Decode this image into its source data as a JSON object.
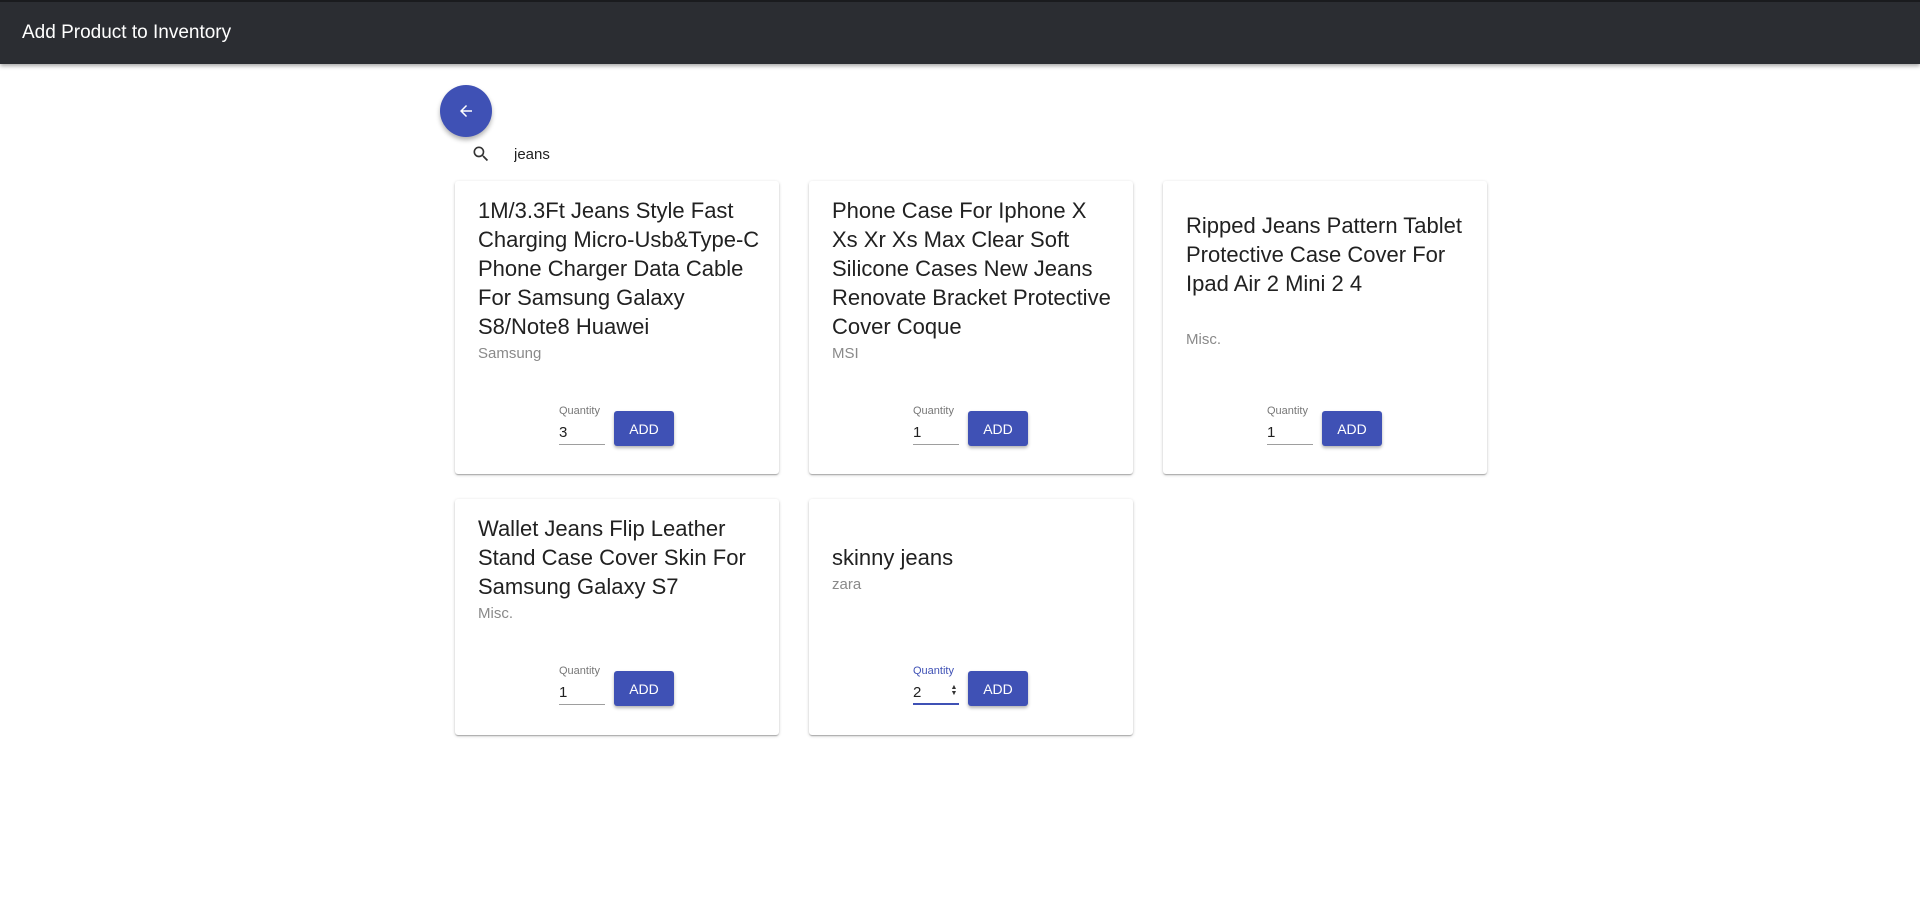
{
  "app": {
    "title": "Add Product to Inventory"
  },
  "toolbar": {
    "back_icon": "arrow-left-icon"
  },
  "search": {
    "icon": "search-icon",
    "value": "jeans"
  },
  "colors": {
    "toolbar_bg": "#2b2d32",
    "primary": "#3f51b5"
  },
  "products": [
    {
      "title": "1M/3.3Ft Jeans Style Fast Charging Micro-Usb&Type-C Phone Charger Data Cable For Samsung Galaxy S8/Note8 Huawei",
      "brand": "Samsung",
      "quantity_label": "Quantity",
      "quantity": "3",
      "add_label": "ADD"
    },
    {
      "title": "Phone Case For Iphone X Xs Xr Xs Max Clear Soft Silicone Cases New Jeans Renovate Bracket Protective Cover Coque",
      "brand": "MSI",
      "quantity_label": "Quantity",
      "quantity": "1",
      "add_label": "ADD"
    },
    {
      "title": "Ripped Jeans Pattern Tablet Protective Case Cover For Ipad Air 2 Mini 2 4",
      "brand": "Misc.",
      "quantity_label": "Quantity",
      "quantity": "1",
      "add_label": "ADD"
    },
    {
      "title": "Wallet Jeans Flip Leather Stand Case Cover Skin For Samsung Galaxy S7",
      "brand": "Misc.",
      "quantity_label": "Quantity",
      "quantity": "1",
      "add_label": "ADD"
    },
    {
      "title": "skinny jeans",
      "brand": "zara",
      "quantity_label": "Quantity",
      "quantity": "2",
      "add_label": "ADD"
    }
  ]
}
